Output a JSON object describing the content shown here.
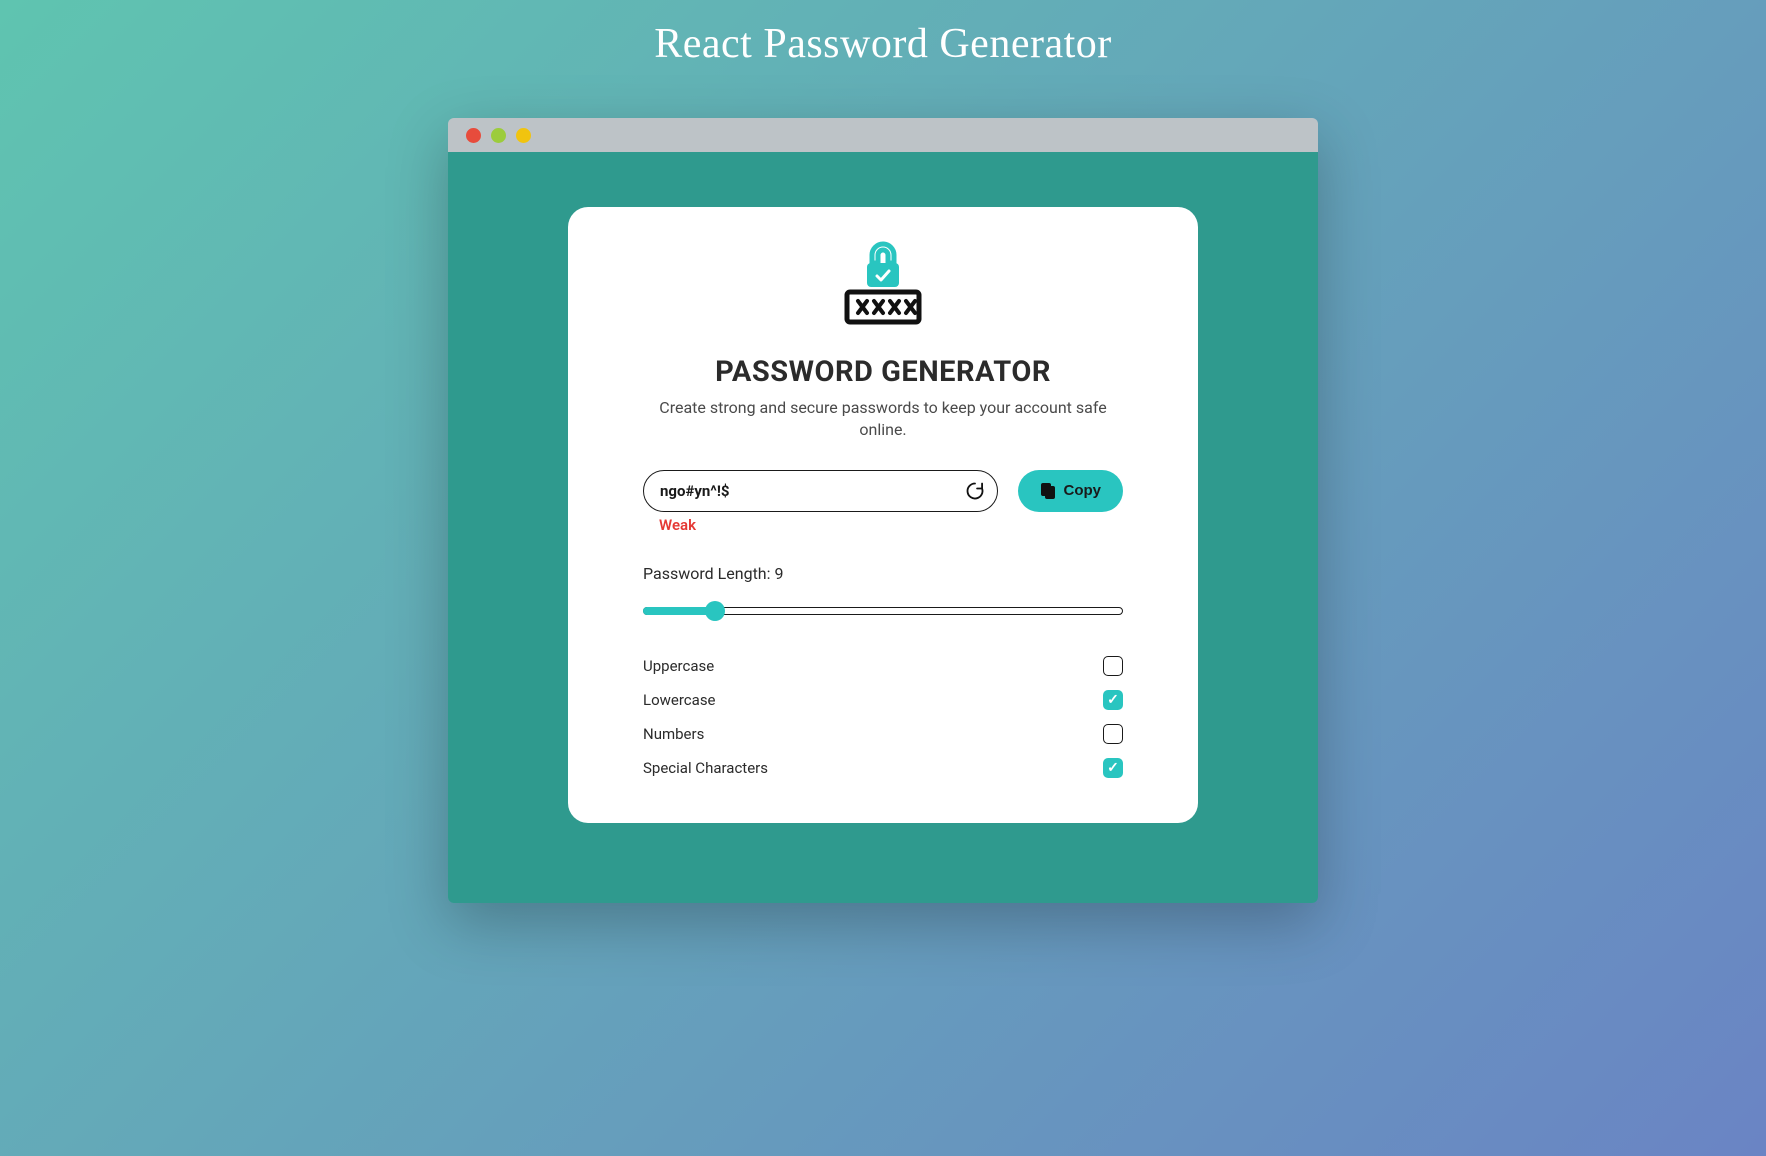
{
  "page": {
    "title": "React Password Generator"
  },
  "card": {
    "title": "PASSWORD GENERATOR",
    "subtitle": "Create strong and secure passwords to keep your account safe online."
  },
  "password": {
    "value": "ngo#yn^!$",
    "strength": "Weak",
    "strength_color": "#e53935"
  },
  "copy": {
    "label": "Copy"
  },
  "length": {
    "label_prefix": "Password Length: ",
    "value": "9",
    "min": 4,
    "max": 40,
    "fill_percent": 15
  },
  "options": [
    {
      "label": "Uppercase",
      "checked": false
    },
    {
      "label": "Lowercase",
      "checked": true
    },
    {
      "label": "Numbers",
      "checked": false
    },
    {
      "label": "Special Characters",
      "checked": true
    }
  ],
  "colors": {
    "accent": "#29c5c0",
    "window_bg": "#2f9a8e"
  }
}
